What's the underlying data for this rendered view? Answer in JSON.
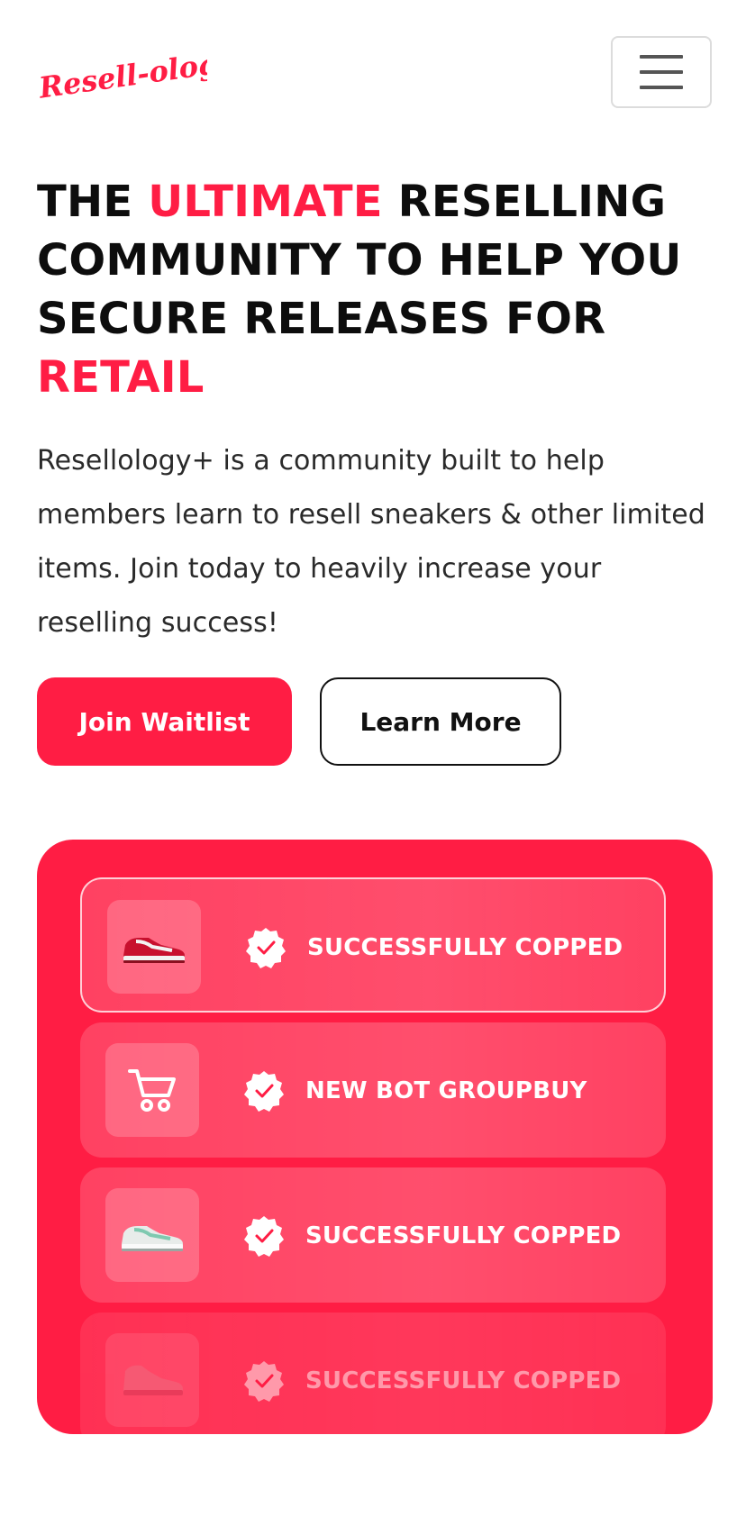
{
  "navbar": {
    "logo_text": "Resell-ology",
    "menu_icon": "hamburger-menu-icon"
  },
  "hero": {
    "title_part1": "THE ",
    "title_accent1": "ULTIMATE",
    "title_part2": " RESELLING COMMUNITY TO HELP YOU SECURE RELEASES FOR ",
    "title_accent2": "RETAIL",
    "description": "Resellology+ is a community built to help members learn to resell sneakers & other limited items. Join today to heavily increase your reselling success!",
    "primary_button": "Join Waitlist",
    "secondary_button": "Learn More"
  },
  "feed": {
    "items": [
      {
        "label": "SUCCESSFULLY COPPED",
        "icon": "red-dunk-sneaker-icon"
      },
      {
        "label": "NEW BOT GROUPBUY",
        "icon": "shopping-cart-icon"
      },
      {
        "label": "SUCCESSFULLY COPPED",
        "icon": "white-green-sneaker-icon"
      },
      {
        "label": "SUCCESSFULLY COPPED",
        "icon": "pink-jordan-sneaker-icon"
      }
    ]
  },
  "colors": {
    "accent": "#ff1d44",
    "text": "#0d0d0d",
    "body_text": "#2a2a2a"
  }
}
